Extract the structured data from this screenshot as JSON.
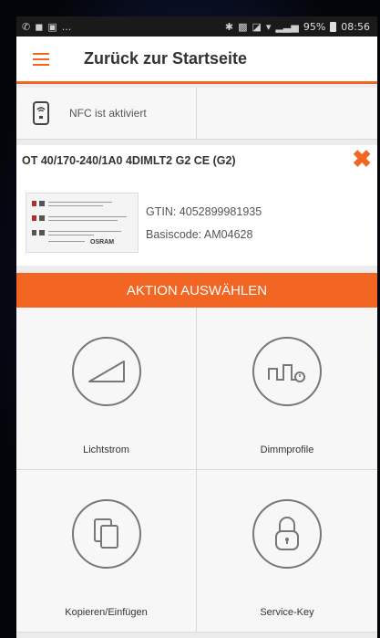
{
  "statusbar": {
    "left_icons": [
      "whatsapp-icon",
      "facebook-icon",
      "photo-icon"
    ],
    "left_more": "...",
    "right_icons": [
      "bluetooth-icon",
      "nfc-icon",
      "vibrate-icon",
      "wifi-icon",
      "signal-icon"
    ],
    "battery_text": "95%",
    "time": "08:56"
  },
  "appbar": {
    "title": "Zurück zur Startseite"
  },
  "nfc": {
    "label": "NFC ist aktiviert"
  },
  "device": {
    "name": "OT 40/170-240/1A0 4DIMLT2 G2 CE  (G2)",
    "gtin": "GTIN: 4052899981935",
    "basiscode": "Basiscode: AM04628",
    "label_brand": "OSRAM"
  },
  "action": {
    "label": "AKTION AUSWÄHLEN"
  },
  "tiles": [
    {
      "label": "Lichtstrom",
      "icon": "ramp-icon"
    },
    {
      "label": "Dimmprofile",
      "icon": "dimming-profile-icon"
    },
    {
      "label": "Kopieren/Einfügen",
      "icon": "copy-icon"
    },
    {
      "label": "Service-Key",
      "icon": "padlock-icon"
    }
  ],
  "colors": {
    "accent": "#f26522",
    "background": "#ececec",
    "statusbar": "#1a1a1a"
  }
}
